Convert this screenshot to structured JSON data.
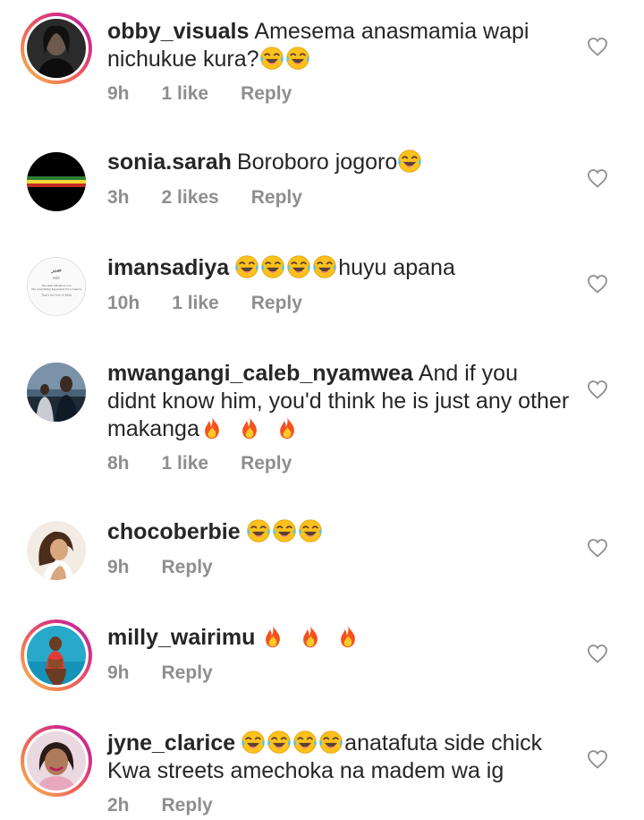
{
  "comments": [
    {
      "username": "obby_visuals",
      "text_before": "Amesema anasmamia wapi nichukue kura?",
      "emojis": [
        "face-with-tears-of-joy-icon",
        "face-with-tears-of-joy-icon"
      ],
      "text_after": "",
      "time": "9h",
      "likes": "1 like",
      "reply": "Reply"
    },
    {
      "username": "sonia.sarah",
      "text_before": "Boroboro jogoro",
      "emojis": [
        "face-with-tears-of-joy-icon"
      ],
      "text_after": "",
      "time": "3h",
      "likes": "2 likes",
      "reply": "Reply"
    },
    {
      "username": "imansadiya",
      "text_before": "",
      "emojis": [
        "face-with-tears-of-joy-icon",
        "face-with-tears-of-joy-icon",
        "face-with-tears-of-joy-icon",
        "face-with-tears-of-joy-icon"
      ],
      "text_after": "huyu apana",
      "time": "10h",
      "likes": "1 like",
      "reply": "Reply"
    },
    {
      "username": "mwangangi_caleb_nyamwea",
      "text_before": "And if you didnt know him, you'd think he is just any other makanga",
      "emojis": [
        "fire-icon",
        "fire-icon",
        "fire-icon"
      ],
      "text_after": "",
      "time": "8h",
      "likes": "1 like",
      "reply": "Reply"
    },
    {
      "username": "chocoberbie",
      "text_before": "",
      "emojis": [
        "face-with-tears-of-joy-icon",
        "face-with-tears-of-joy-icon",
        "face-with-tears-of-joy-icon"
      ],
      "text_after": "",
      "time": "9h",
      "likes": "",
      "reply": "Reply"
    },
    {
      "username": "milly_wairimu",
      "text_before": "",
      "emojis": [
        "fire-icon",
        "fire-icon",
        "fire-icon"
      ],
      "text_after": "",
      "time": "9h",
      "likes": "",
      "reply": "Reply"
    },
    {
      "username": "jyne_clarice",
      "text_before": "",
      "emojis": [
        "face-with-tears-of-joy-icon",
        "face-with-tears-of-joy-icon",
        "face-with-tears-of-joy-icon",
        "face-with-tears-of-joy-icon"
      ],
      "text_after": "anatafuta side chick Kwa streets amechoka na madem wa ig",
      "time": "2h",
      "likes": "",
      "reply": "Reply"
    }
  ],
  "avatar_quote": {
    "arabic": "صبر",
    "line1": "Sabr",
    "line2": "The wall will show you",
    "line3": "the everything happened for a reason",
    "line4": "That's the love of Allah"
  },
  "colors": {
    "text": "#262626",
    "meta": "#8e8e8e",
    "story_ring_start": "#f6c14b",
    "story_ring_end": "#b32ba5"
  }
}
